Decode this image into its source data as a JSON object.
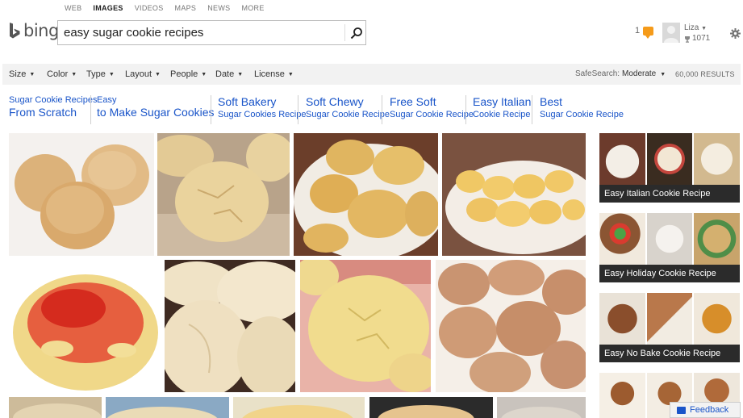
{
  "scopes": [
    {
      "label": "WEB"
    },
    {
      "label": "IMAGES"
    },
    {
      "label": "VIDEOS"
    },
    {
      "label": "MAPS"
    },
    {
      "label": "NEWS"
    },
    {
      "label": "MORE"
    }
  ],
  "logo": {
    "text": "bing"
  },
  "search": {
    "value": "easy sugar cookie recipes"
  },
  "header": {
    "notification_count": "1",
    "user_name": "Liza",
    "rewards": "1071"
  },
  "filters": {
    "items": [
      "Size",
      "Color",
      "Type",
      "Layout",
      "People",
      "Date",
      "License"
    ],
    "safesearch_label": "SafeSearch:",
    "safesearch_value": "Moderate",
    "results": "60,000 RESULTS"
  },
  "related": [
    {
      "line1": "Sugar Cookie Recipes",
      "line2": "From Scratch"
    },
    {
      "line1": "Easy",
      "line2": "to Make Sugar Cookies"
    },
    {
      "line1": "Soft Bakery",
      "line2": "Sugar Cookies Recipe"
    },
    {
      "line1": "Soft Chewy",
      "line2": "Sugar Cookie Recipe"
    },
    {
      "line1": "Free Soft",
      "line2": "Sugar Cookie Recipe"
    },
    {
      "line1": "Easy Italian",
      "line2": "Cookie Recipe"
    },
    {
      "line1": "Best",
      "line2": "Sugar Cookie Recipe"
    }
  ],
  "side_tiles": [
    {
      "caption": "Easy Italian Cookie Recipe"
    },
    {
      "caption": "Easy Holiday Cookie Recipe"
    },
    {
      "caption": "Easy No Bake Cookie Recipe"
    }
  ],
  "feedback": {
    "label": "Feedback"
  }
}
